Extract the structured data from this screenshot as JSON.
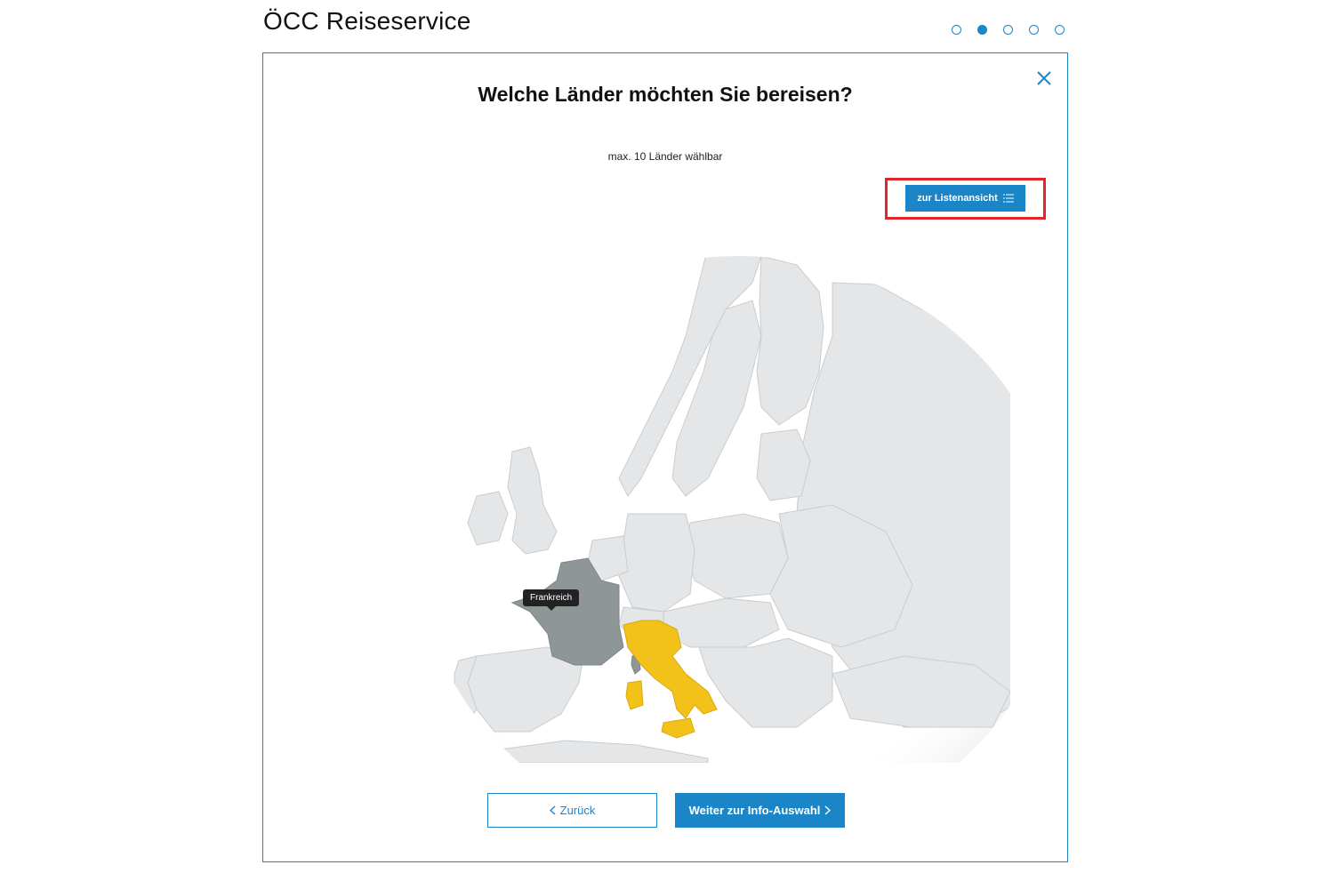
{
  "app": {
    "title": "ÖCC Reiseservice"
  },
  "stepper": {
    "steps": 5,
    "active_index": 1
  },
  "dialog": {
    "title": "Welche Länder möchten Sie bereisen?",
    "hint": "max. 10 Länder wählbar",
    "list_view_button": "zur Listenansicht",
    "close_icon": "close-icon",
    "list_icon": "list-icon"
  },
  "map": {
    "hover_tooltip": "Frankreich",
    "colors": {
      "land": "#e4e6e7",
      "border": "#c9cdd0",
      "hovered": "#8f9698",
      "selected": "#f2c21b",
      "accent": "#1a86c8",
      "highlight": "#e0252b"
    }
  },
  "footer": {
    "back_label": "Zurück",
    "next_label": "Weiter zur Info-Auswahl"
  }
}
